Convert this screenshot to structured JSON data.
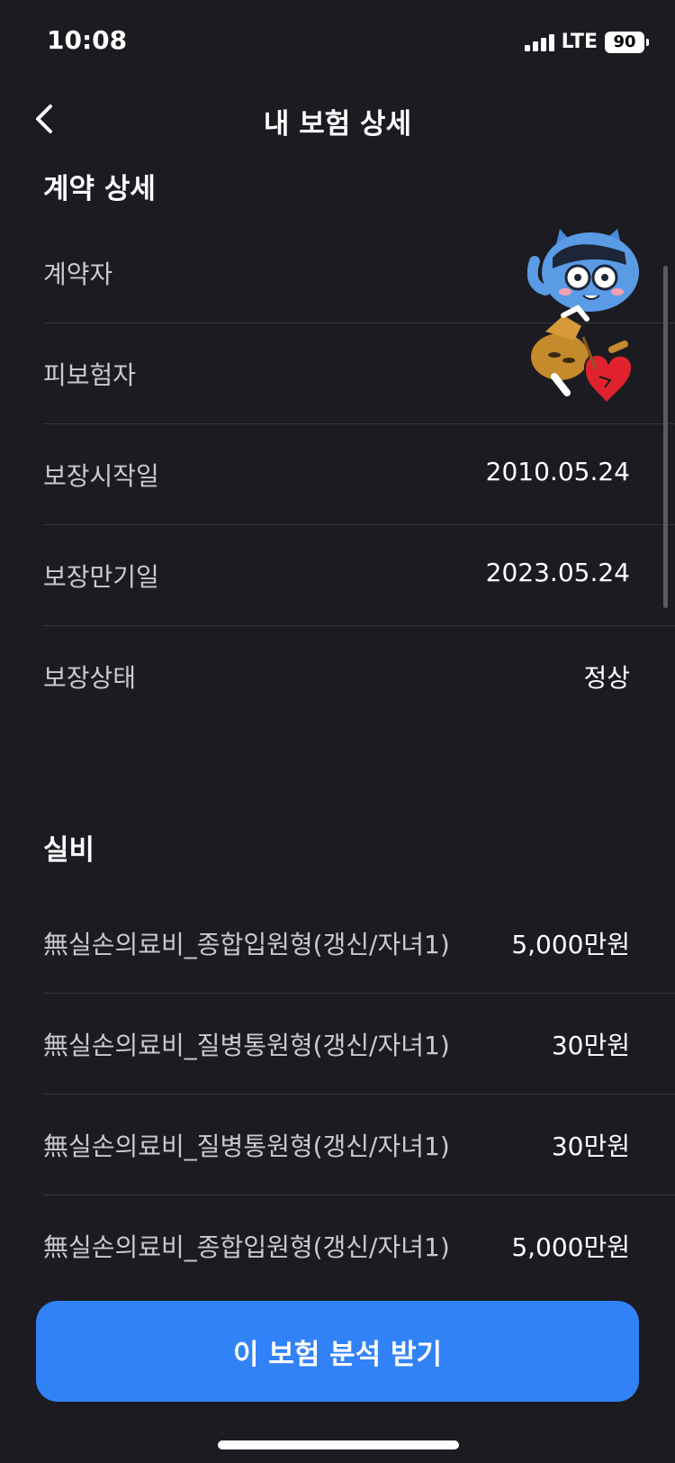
{
  "status_bar": {
    "time": "10:08",
    "network": "LTE",
    "battery": "90"
  },
  "nav": {
    "title": "내 보험 상세"
  },
  "contract": {
    "title": "계약 상세",
    "rows": [
      {
        "label": "계약자",
        "value": ""
      },
      {
        "label": "피보험자",
        "value": ""
      },
      {
        "label": "보장시작일",
        "value": "2010.05.24"
      },
      {
        "label": "보장만기일",
        "value": "2023.05.24"
      },
      {
        "label": "보장상태",
        "value": "정상"
      }
    ]
  },
  "medical": {
    "title": "실비",
    "rows": [
      {
        "label": "無실손의료비_종합입원형(갱신/자녀1)",
        "value": "5,000만원"
      },
      {
        "label": "無실손의료비_질병통원형(갱신/자녀1)",
        "value": "30만원"
      },
      {
        "label": "無실손의료비_질병통원형(갱신/자녀1)",
        "value": "30만원"
      },
      {
        "label": "無실손의료비_종합입원형(갱신/자녀1)",
        "value": "5,000만원"
      }
    ]
  },
  "cta": {
    "label": "이 보험 분석 받기"
  },
  "colors": {
    "background": "#1b1b21",
    "accent": "#3182f6",
    "divider": "#34343b"
  },
  "icons": {
    "back": "chevron-left-icon",
    "sticker": "character-sticker-icon"
  }
}
